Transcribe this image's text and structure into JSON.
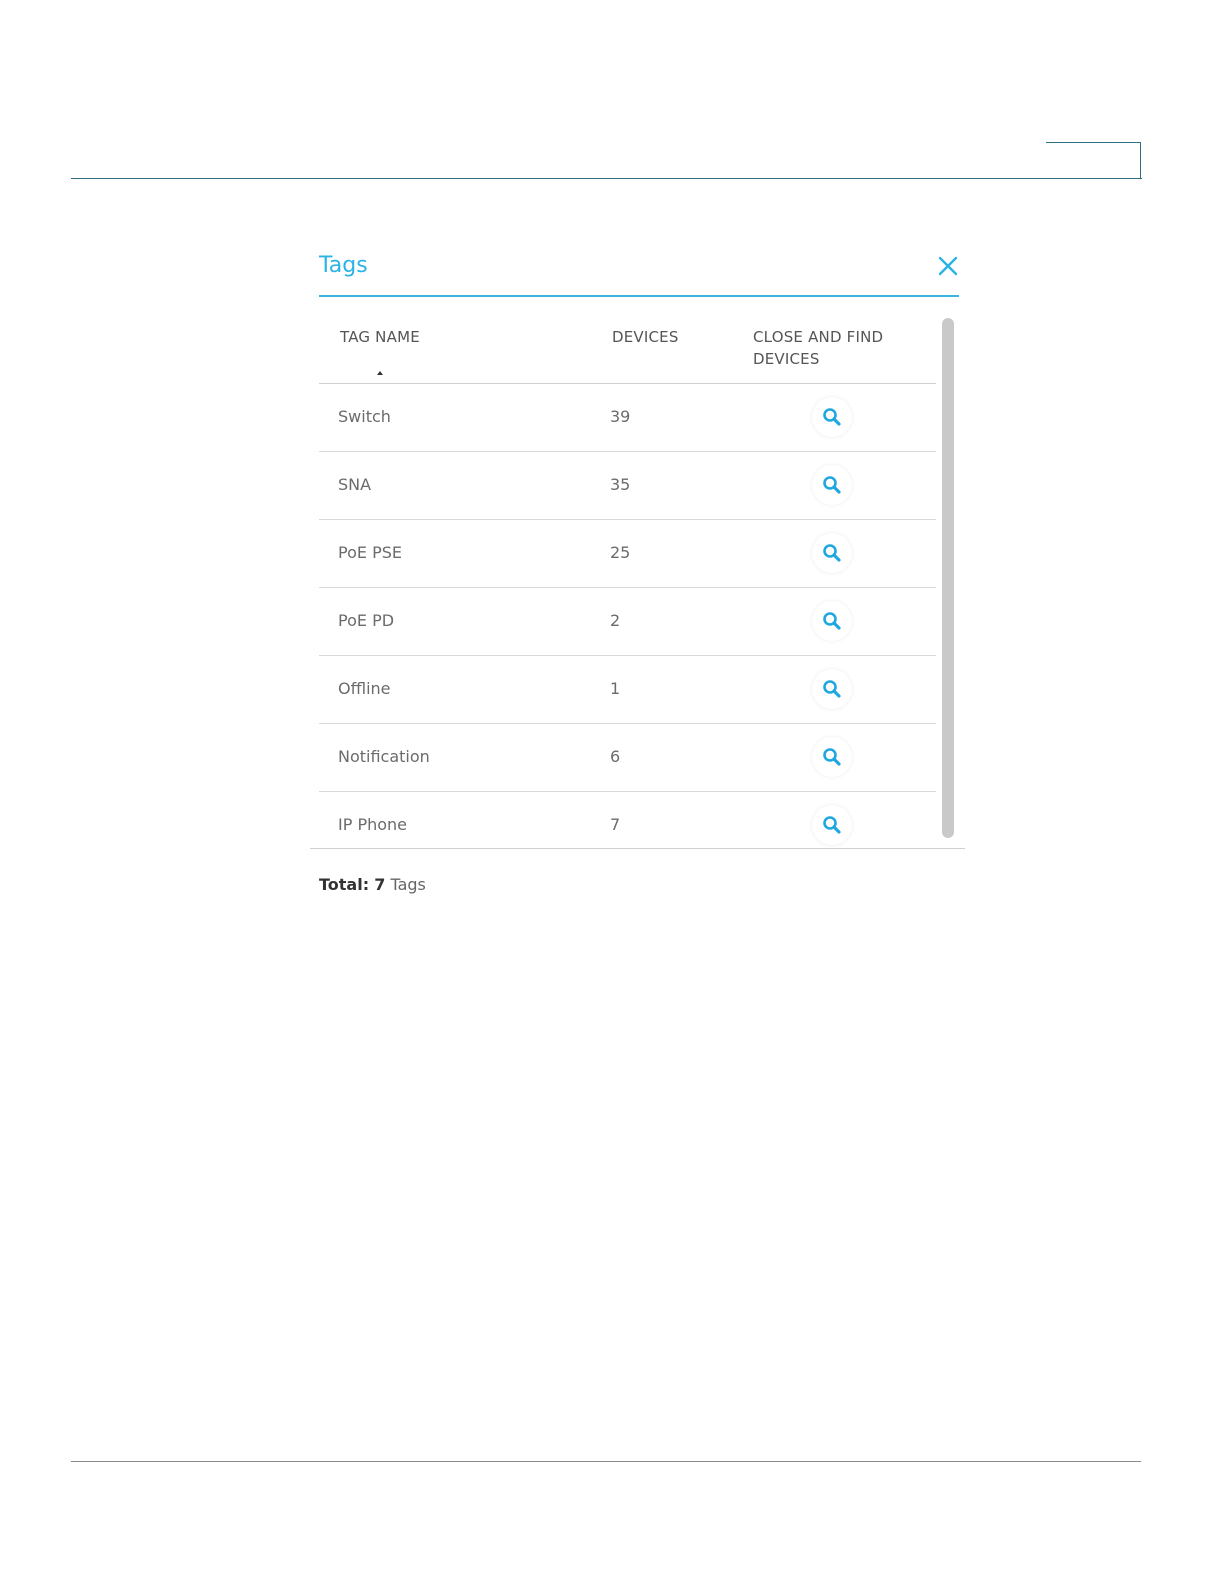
{
  "dialog": {
    "title": "Tags",
    "close_icon": "close-icon"
  },
  "table": {
    "headers": {
      "tag_name": "TAG NAME",
      "devices": "DEVICES",
      "close_and_find": "CLOSE AND FIND DEVICES"
    },
    "sort_indicator": "ascending",
    "rows": [
      {
        "name": "Switch",
        "devices": "39"
      },
      {
        "name": "SNA",
        "devices": "35"
      },
      {
        "name": "PoE PSE",
        "devices": "25"
      },
      {
        "name": "PoE PD",
        "devices": "2"
      },
      {
        "name": "Offline",
        "devices": "1"
      },
      {
        "name": "Notification",
        "devices": "6"
      },
      {
        "name": "IP Phone",
        "devices": "7"
      }
    ],
    "row_action_icon": "search-icon"
  },
  "footer": {
    "total_label": "Total:",
    "total_count": "7",
    "total_unit": "Tags"
  },
  "colors": {
    "accent": "#2bb3e6",
    "text": "#6b6b6b"
  }
}
